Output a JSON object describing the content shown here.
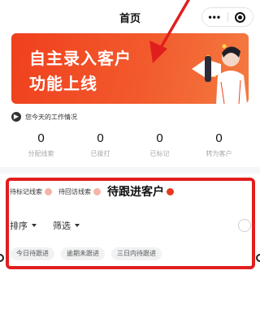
{
  "navbar": {
    "title": "首页"
  },
  "banner": {
    "line1": "自主录入客户",
    "line2": "功能上线"
  },
  "section": {
    "title": "您今天的工作情况"
  },
  "stats": [
    {
      "value": "0",
      "label": "分配线索"
    },
    {
      "value": "0",
      "label": "已拨打"
    },
    {
      "value": "0",
      "label": "已标记"
    },
    {
      "value": "0",
      "label": "转为客户"
    }
  ],
  "tabs": [
    {
      "label": "待标记线索"
    },
    {
      "label": "待回访线索"
    },
    {
      "label": "待跟进客户"
    }
  ],
  "filters": {
    "sort": "排序",
    "filter": "筛选"
  },
  "chips": [
    "今日待跟进",
    "逾期未跟进",
    "三日内待跟进"
  ],
  "colors": {
    "brand": "#f0401e",
    "annotation": "#e11e1e",
    "badge_active": "#e8391f"
  }
}
